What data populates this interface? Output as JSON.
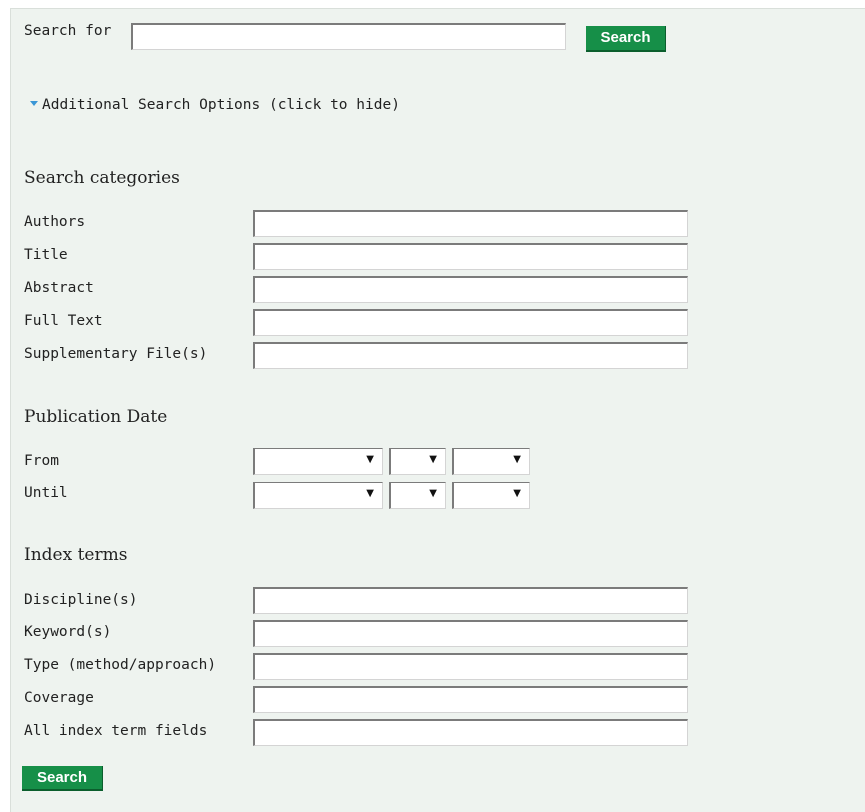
{
  "search": {
    "label": "Search for",
    "value": "",
    "button_label": "Search"
  },
  "options_toggle": {
    "icon": "triangle-down-icon",
    "label": "Additional Search Options (click to hide)"
  },
  "categories": {
    "heading": "Search categories",
    "fields": [
      {
        "label": "Authors",
        "value": ""
      },
      {
        "label": "Title",
        "value": ""
      },
      {
        "label": "Abstract",
        "value": ""
      },
      {
        "label": "Full Text",
        "value": ""
      },
      {
        "label": "Supplementary File(s)",
        "value": ""
      }
    ]
  },
  "publication_date": {
    "heading": "Publication Date",
    "from_label": "From",
    "until_label": "Until",
    "from": {
      "month": "",
      "day": "",
      "year": ""
    },
    "until": {
      "month": "",
      "day": "",
      "year": ""
    }
  },
  "index_terms": {
    "heading": "Index terms",
    "fields": [
      {
        "label": "Discipline(s)",
        "value": ""
      },
      {
        "label": "Keyword(s)",
        "value": ""
      },
      {
        "label": "Type (method/approach)",
        "value": ""
      },
      {
        "label": "Coverage",
        "value": ""
      },
      {
        "label": "All index term fields",
        "value": ""
      }
    ]
  },
  "footer": {
    "button_label": "Search"
  },
  "colors": {
    "panel_background": "#eef3ef",
    "button_green": "#168f48",
    "toggle_arrow": "#3a96d6"
  }
}
